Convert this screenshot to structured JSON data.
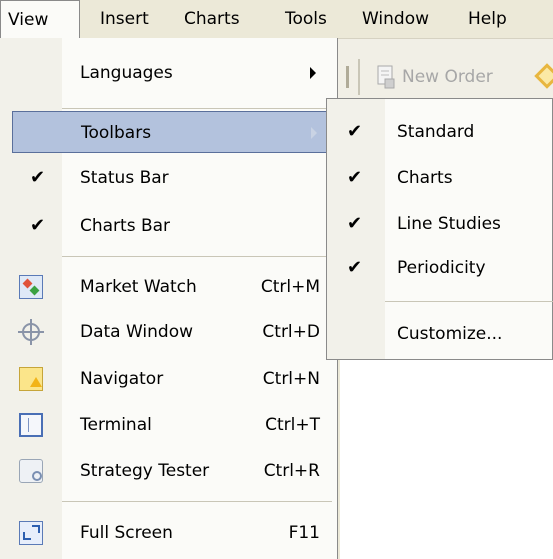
{
  "menubar": {
    "items": [
      "View",
      "Insert",
      "Charts",
      "Tools",
      "Window",
      "Help"
    ]
  },
  "toolbar": {
    "new_order_label": "New Order"
  },
  "view_menu": {
    "languages": "Languages",
    "toolbars": "Toolbars",
    "status_bar": "Status Bar",
    "charts_bar": "Charts Bar",
    "market_watch": {
      "label": "Market Watch",
      "shortcut": "Ctrl+M"
    },
    "data_window": {
      "label": "Data Window",
      "shortcut": "Ctrl+D"
    },
    "navigator": {
      "label": "Navigator",
      "shortcut": "Ctrl+N"
    },
    "terminal": {
      "label": "Terminal",
      "shortcut": "Ctrl+T"
    },
    "strategy_tester": {
      "label": "Strategy Tester",
      "shortcut": "Ctrl+R"
    },
    "full_screen": {
      "label": "Full Screen",
      "shortcut": "F11"
    }
  },
  "toolbars_submenu": {
    "items": [
      "Standard",
      "Charts",
      "Line Studies",
      "Periodicity"
    ],
    "customize": "Customize..."
  },
  "check_glyph": "✔",
  "colors": {
    "highlight": "#b3c2dd",
    "menu_bg": "#fbfbf8",
    "chrome_bg": "#ece9d8"
  },
  "icons": {
    "market_watch": "market-watch-icon",
    "data_window": "crosshair-icon",
    "navigator": "navigator-folder-icon",
    "terminal": "terminal-window-icon",
    "strategy_tester": "strategy-tester-icon",
    "full_screen": "full-screen-icon"
  }
}
